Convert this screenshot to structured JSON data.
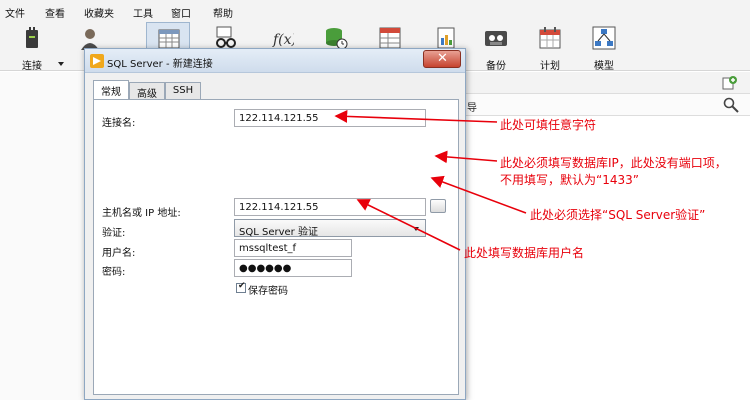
{
  "menu": [
    "文件",
    "查看",
    "收藏夹",
    "工具",
    "窗口",
    "帮助"
  ],
  "toolbar": {
    "connect": "连接",
    "backup": "备份",
    "schedule": "计划",
    "model": "模型"
  },
  "right_panel": {
    "fragment": "导"
  },
  "dialog": {
    "title": "SQL Server - 新建连接",
    "close": "✕",
    "tabs": [
      "常规",
      "高级",
      "SSH"
    ],
    "connection_name_label": "连接名:",
    "connection_name_value": "122.114.121.55",
    "host_label": "主机名或 IP 地址:",
    "host_value": "122.114.121.55",
    "auth_label": "验证:",
    "auth_value": "SQL Server 验证",
    "username_label": "用户名:",
    "username_value": "mssqltest_f",
    "password_label": "密码:",
    "password_value": "●●●●●●",
    "save_password_label": "保存密码",
    "save_password_checked": true
  },
  "annotations": {
    "name_note": "此处可填任意字符",
    "host_note_line1": "此处必须填写数据库IP，此处没有端口项，",
    "host_note_line2": "不用填写，默认为“1433”",
    "auth_note": "此处必须选择“SQL Server验证”",
    "user_note": "此处填写数据库用户名"
  },
  "colors": {
    "annotation": "#e8000b",
    "titlebar": "#cfdcec",
    "close_button": "#c6432f"
  }
}
